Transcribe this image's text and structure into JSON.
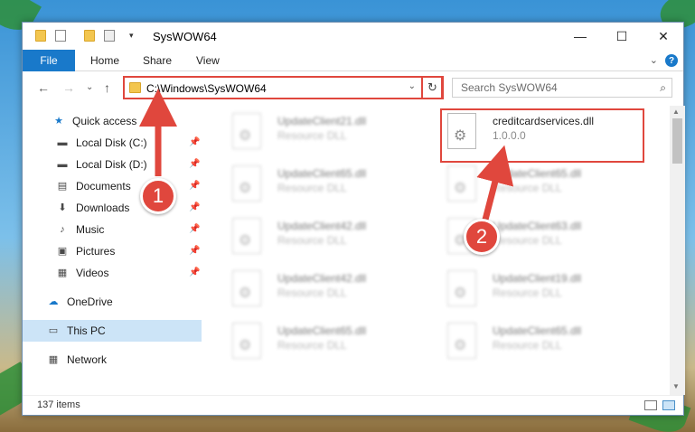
{
  "window": {
    "title": "SysWOW64",
    "minimize_glyph": "—",
    "maximize_glyph": "☐",
    "close_glyph": "✕"
  },
  "ribbon": {
    "file": "File",
    "home": "Home",
    "share": "Share",
    "view": "View",
    "expand_glyph": "⌄",
    "help_glyph": "?"
  },
  "address": {
    "path": "C:\\Windows\\SysWOW64",
    "back_glyph": "←",
    "forward_glyph": "→",
    "recent_glyph": "⌄",
    "up_glyph": "↑",
    "dropdown_glyph": "⌄",
    "refresh_glyph": "↻"
  },
  "search": {
    "placeholder": "Search SysWOW64",
    "icon": "search-icon",
    "glyph": "⌕"
  },
  "sidebar": {
    "items": [
      {
        "label": "Quick access",
        "icon": "star-icon",
        "glyph": "★",
        "pinned": false
      },
      {
        "label": "Local Disk (C:)",
        "icon": "drive-icon",
        "glyph": "▬",
        "pinned": true
      },
      {
        "label": "Local Disk (D:)",
        "icon": "drive-icon",
        "glyph": "▬",
        "pinned": true
      },
      {
        "label": "Documents",
        "icon": "document-icon",
        "glyph": "▤",
        "pinned": true
      },
      {
        "label": "Downloads",
        "icon": "download-icon",
        "glyph": "⬇",
        "pinned": true
      },
      {
        "label": "Music",
        "icon": "music-icon",
        "glyph": "♪",
        "pinned": true
      },
      {
        "label": "Pictures",
        "icon": "pictures-icon",
        "glyph": "▣",
        "pinned": true
      },
      {
        "label": "Videos",
        "icon": "video-icon",
        "glyph": "▦",
        "pinned": true
      },
      {
        "label": "OneDrive",
        "icon": "cloud-icon",
        "glyph": "☁",
        "pinned": false
      },
      {
        "label": "This PC",
        "icon": "computer-icon",
        "glyph": "▭",
        "pinned": false
      },
      {
        "label": "Network",
        "icon": "network-icon",
        "glyph": "▦",
        "pinned": false
      }
    ],
    "pin_glyph": "📌"
  },
  "files": {
    "left": [
      {
        "name": "UpdateClient21.dll",
        "type": "Resource DLL"
      },
      {
        "name": "UpdateClient65.dll",
        "type": "Resource DLL"
      },
      {
        "name": "UpdateClient42.dll",
        "type": "Resource DLL"
      },
      {
        "name": "UpdateClient42.dll",
        "type": "Resource DLL"
      },
      {
        "name": "UpdateClient65.dll",
        "type": "Resource DLL"
      }
    ],
    "right": [
      {
        "name": "creditcardservices.dll",
        "type": "1.0.0.0"
      },
      {
        "name": "UpdateClient65.dll",
        "type": "Resource DLL"
      },
      {
        "name": "UpdateClient63.dll",
        "type": "Resource DLL"
      },
      {
        "name": "UpdateClient19.dll",
        "type": "Resource DLL"
      },
      {
        "name": "UpdateClient65.dll",
        "type": "Resource DLL"
      }
    ],
    "gear_glyph": "⚙"
  },
  "scrollbar": {
    "up_glyph": "▲",
    "down_glyph": "▼"
  },
  "status": {
    "count": "137 items"
  },
  "callouts": {
    "one": "1",
    "two": "2"
  },
  "colors": {
    "accent": "#1979ca",
    "callout": "#e0473d",
    "selected": "#cce4f7"
  }
}
